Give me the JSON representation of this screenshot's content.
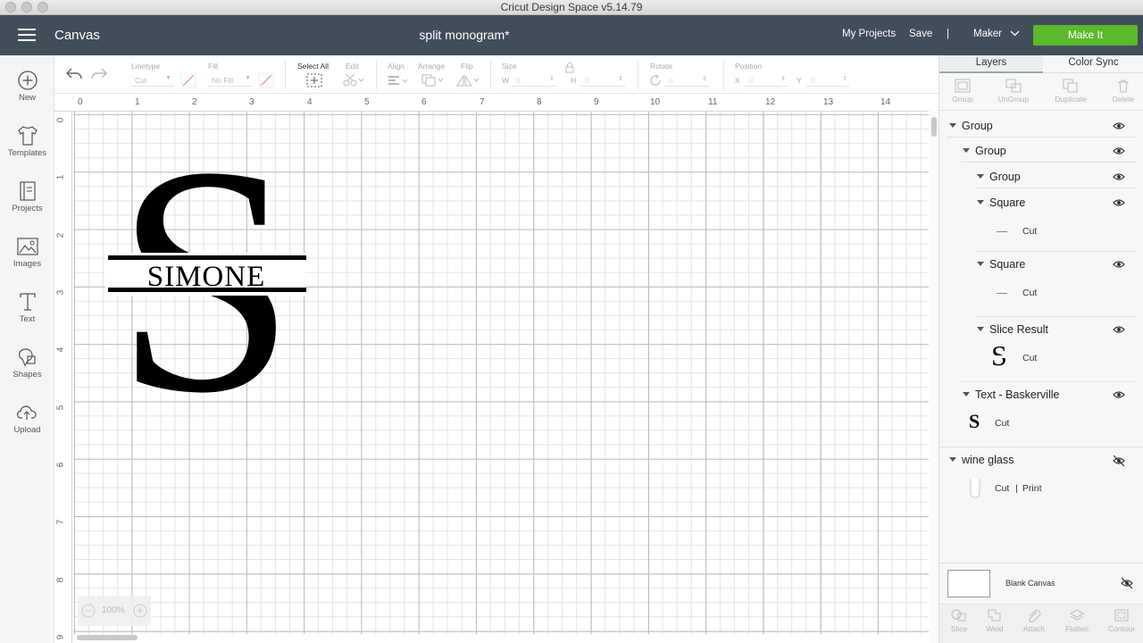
{
  "window": {
    "title": "Cricut Design Space  v5.14.79"
  },
  "header": {
    "canvas_label": "Canvas",
    "project_title": "split monogram*",
    "my_projects": "My Projects",
    "save": "Save",
    "separator": "|",
    "machine": "Maker",
    "make_it": "Make It",
    "make_it_color": "#5cb82c"
  },
  "leftnav": {
    "items": [
      {
        "label": "New",
        "icon": "plus-circle-icon"
      },
      {
        "label": "Templates",
        "icon": "tshirt-icon"
      },
      {
        "label": "Projects",
        "icon": "notebook-icon"
      },
      {
        "label": "Images",
        "icon": "image-icon"
      },
      {
        "label": "Text",
        "icon": "text-icon"
      },
      {
        "label": "Shapes",
        "icon": "shapes-icon"
      },
      {
        "label": "Upload",
        "icon": "upload-cloud-icon"
      }
    ]
  },
  "toolbar": {
    "linetype_label": "Linetype",
    "linetype_value": "Cut",
    "fill_label": "Fill",
    "fill_value": "No Fill",
    "select_all_label": "Select All",
    "edit_label": "Edit",
    "align_label": "Align",
    "arrange_label": "Arrange",
    "flip_label": "Flip",
    "size_label": "Size",
    "w_label": "W",
    "h_label": "H",
    "rotate_label": "Rotate",
    "position_label": "Position",
    "x_label": "X",
    "y_label": "Y",
    "w_value": "0",
    "h_value": "0",
    "rotate_value": "0",
    "x_value": "0",
    "y_value": "0"
  },
  "canvas": {
    "ruler_top": [
      "0",
      "1",
      "2",
      "3",
      "4",
      "5",
      "6",
      "7",
      "8",
      "9",
      "10",
      "11",
      "12",
      "13",
      "14"
    ],
    "ruler_left": [
      "0",
      "1",
      "2",
      "3",
      "4",
      "5",
      "6",
      "7",
      "8",
      "9"
    ],
    "monogram_letter": "S",
    "monogram_name": "SIMONE",
    "zoom_level": "100%"
  },
  "rightpanel": {
    "tabs": {
      "layers": "Layers",
      "color_sync": "Color Sync"
    },
    "tools": {
      "group": "Group",
      "ungroup": "UnGroup",
      "duplicate": "Duplicate",
      "delete": "Delete"
    },
    "layers": {
      "group1": "Group",
      "group2": "Group",
      "group3": "Group",
      "square1": "Square",
      "square1_op": "Cut",
      "square2": "Square",
      "square2_op": "Cut",
      "slice": "Slice Result",
      "slice_op": "Cut",
      "slice_glyph": "S",
      "text": "Text - Baskerville",
      "text_op": "Cut",
      "text_glyph": "S",
      "wine": "wine glass",
      "wine_op_cut": "Cut",
      "wine_op_sep": "|",
      "wine_op_print": "Print"
    },
    "blank_canvas": "Blank Canvas",
    "bottom_tools": {
      "slice": "Slice",
      "weld": "Weld",
      "attach": "Attach",
      "flatten": "Flatten",
      "contour": "Contour"
    }
  }
}
